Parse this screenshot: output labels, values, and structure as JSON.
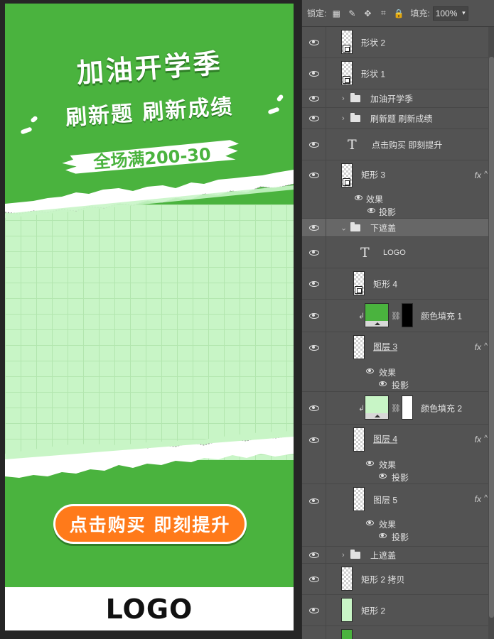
{
  "canvas": {
    "headline": "加油开学季",
    "subheadline": "刷新题 刷新成绩",
    "promo": "全场满200-30",
    "cta_label": "点击购买  即刻提升",
    "logo": "LOGO",
    "colors": {
      "background_green": "#4ab33e",
      "grid_paper": "#c8f5c6",
      "cta_orange": "#ff7a1a",
      "logo_bar": "#ffffff"
    }
  },
  "panel": {
    "lock_label": "锁定:",
    "lock_icons": [
      "lock-transparent-pixels-icon",
      "lock-image-pixels-icon",
      "lock-position-icon",
      "lock-artboard-icon",
      "lock-all-icon"
    ],
    "fill_label": "填充:",
    "fill_value": "100%",
    "layers": [
      {
        "name": "形状 2",
        "kind": "shape"
      },
      {
        "name": "形状 1",
        "kind": "shape"
      },
      {
        "name": "加油开学季",
        "kind": "group-collapsed"
      },
      {
        "name": "刷新题 刷新成绩",
        "kind": "group-collapsed"
      },
      {
        "name": "点击购买 即刻提升",
        "kind": "text"
      },
      {
        "name": "矩形 3",
        "kind": "shape",
        "fx": "fx",
        "effects_label": "效果",
        "effect": "投影"
      },
      {
        "name": "下遮盖",
        "kind": "group-expanded",
        "selected": true
      },
      {
        "name": "LOGO",
        "kind": "text"
      },
      {
        "name": "矩形 4",
        "kind": "shape"
      },
      {
        "name": "颜色填充 1",
        "kind": "fill",
        "fill_color": "#4ab33e",
        "mask": "black"
      },
      {
        "name": "图层 3",
        "kind": "layer",
        "fx": "fx",
        "effects_label": "效果",
        "effect": "投影"
      },
      {
        "name": "颜色填充 2",
        "kind": "fill",
        "fill_color": "#c8f5c6",
        "mask": "white"
      },
      {
        "name": "图层 4",
        "kind": "layer",
        "fx": "fx",
        "effects_label": "效果",
        "effect": "投影"
      },
      {
        "name": "图层 5",
        "kind": "layer",
        "fx": "fx",
        "effects_label": "效果",
        "effect": "投影"
      },
      {
        "name": "上遮盖",
        "kind": "group-collapsed"
      },
      {
        "name": "矩形 2 拷贝",
        "kind": "layer"
      },
      {
        "name": "矩形 2",
        "kind": "layer"
      }
    ]
  }
}
